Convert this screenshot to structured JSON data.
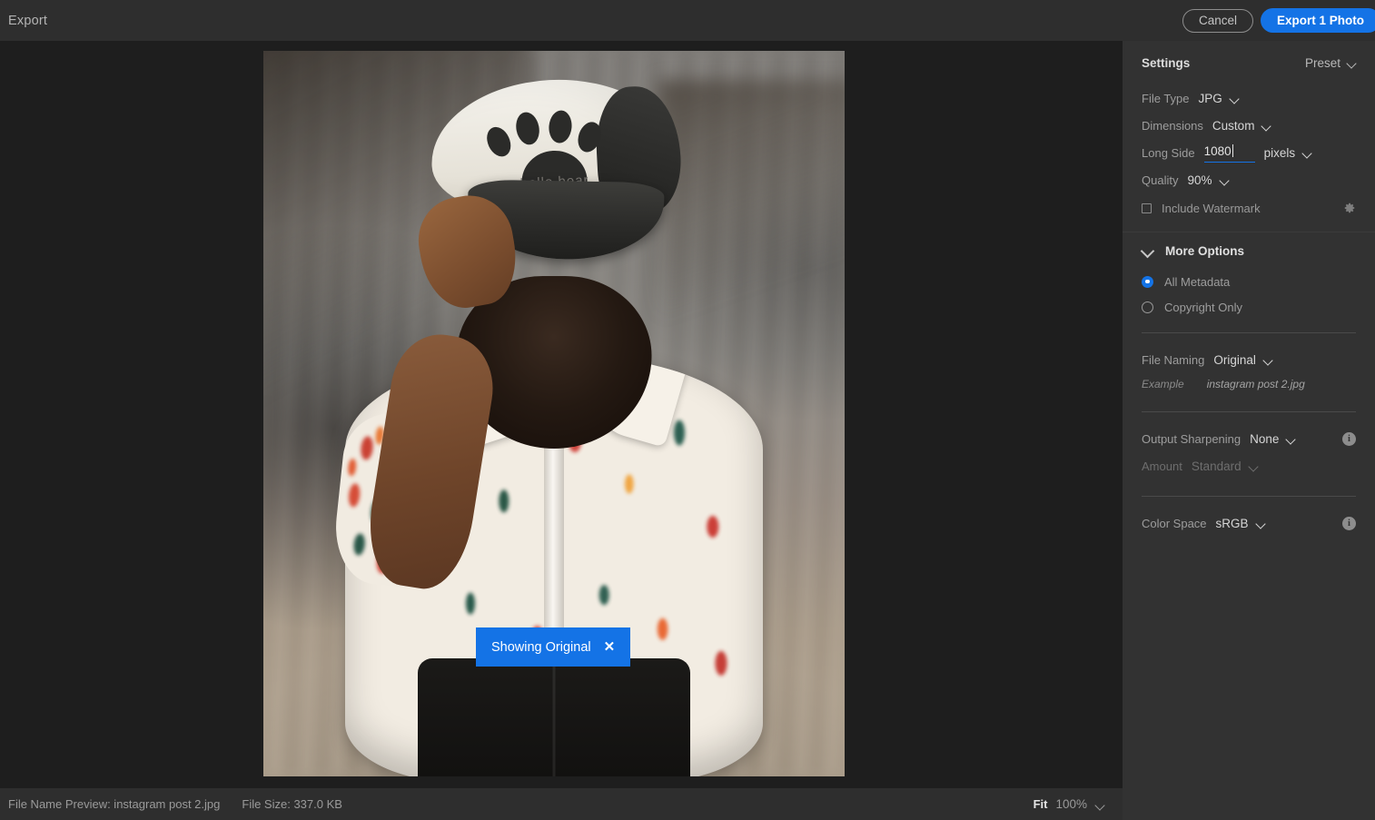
{
  "topbar": {
    "title": "Export",
    "cancel_label": "Cancel",
    "export_label": "Export 1 Photo"
  },
  "canvas": {
    "showing_original_label": "Showing Original",
    "close_icon": "close-icon",
    "photo": {
      "cap_text": "hello bear",
      "subject": "man in floral shirt wearing paw-print trucker cap"
    }
  },
  "bottombar": {
    "file_name_preview": "File Name Preview: instagram post 2.jpg",
    "file_size": "File Size: 337.0 KB",
    "fit_label": "Fit",
    "zoom_level": "100%"
  },
  "panel": {
    "title": "Settings",
    "preset_label": "Preset",
    "settings": {
      "file_type_label": "File Type",
      "file_type_value": "JPG",
      "dimensions_label": "Dimensions",
      "dimensions_value": "Custom",
      "long_side_label": "Long Side",
      "long_side_value": "1080",
      "long_side_unit": "pixels",
      "quality_label": "Quality",
      "quality_value": "90%",
      "watermark_label": "Include Watermark",
      "watermark_checked": false,
      "watermark_settings_icon": "gear-icon"
    },
    "more_options": {
      "header": "More Options",
      "metadata_all_label": "All Metadata",
      "metadata_copyright_label": "Copyright Only",
      "metadata_selected": "All Metadata"
    },
    "file_naming": {
      "label": "File Naming",
      "value": "Original",
      "example_label": "Example",
      "example_value": "instagram post 2.jpg"
    },
    "sharpening": {
      "label": "Output Sharpening",
      "value": "None",
      "amount_label": "Amount",
      "amount_value": "Standard"
    },
    "color_space": {
      "label": "Color Space",
      "value": "sRGB"
    }
  },
  "colors": {
    "accent": "#1473e6",
    "topbar_bg": "#2e2e2e",
    "canvas_bg": "#1e1e1e",
    "panel_bg": "#323232"
  }
}
